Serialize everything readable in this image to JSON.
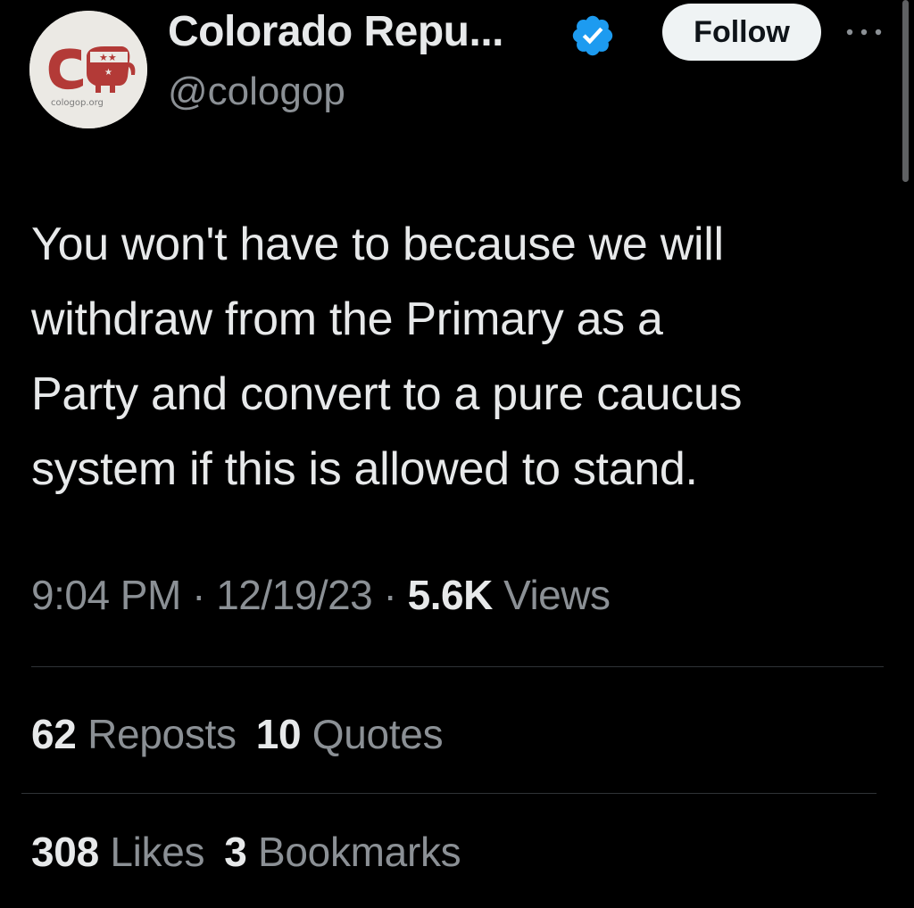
{
  "account": {
    "display_name": "Colorado Repu...",
    "handle": "@cologop",
    "avatar_logo_text": "cologop.org",
    "avatar_logo_mark": "CO"
  },
  "header": {
    "follow_label": "Follow"
  },
  "tweet": {
    "text": "You won't have to because we will\nwithdraw from the Primary as a\nParty and convert to a pure caucus\nsystem if this is allowed to stand.",
    "time": "9:04 PM",
    "separator": "·",
    "date": "12/19/23",
    "views_count": "5.6K",
    "views_label": "Views"
  },
  "stats": {
    "reposts_count": "62",
    "reposts_label": "Reposts",
    "quotes_count": "10",
    "quotes_label": "Quotes",
    "likes_count": "308",
    "likes_label": "Likes",
    "bookmarks_count": "3",
    "bookmarks_label": "Bookmarks"
  },
  "icons": {
    "verified": "verified-badge-icon",
    "more": "more-options-icon"
  },
  "colors": {
    "background": "#000000",
    "primary_text": "#e7e9ea",
    "secondary_text": "#8b9095",
    "verified_blue": "#1d9bf0",
    "divider": "#2f3336",
    "logo_red": "#b33a37",
    "follow_bg": "#eff3f4"
  }
}
